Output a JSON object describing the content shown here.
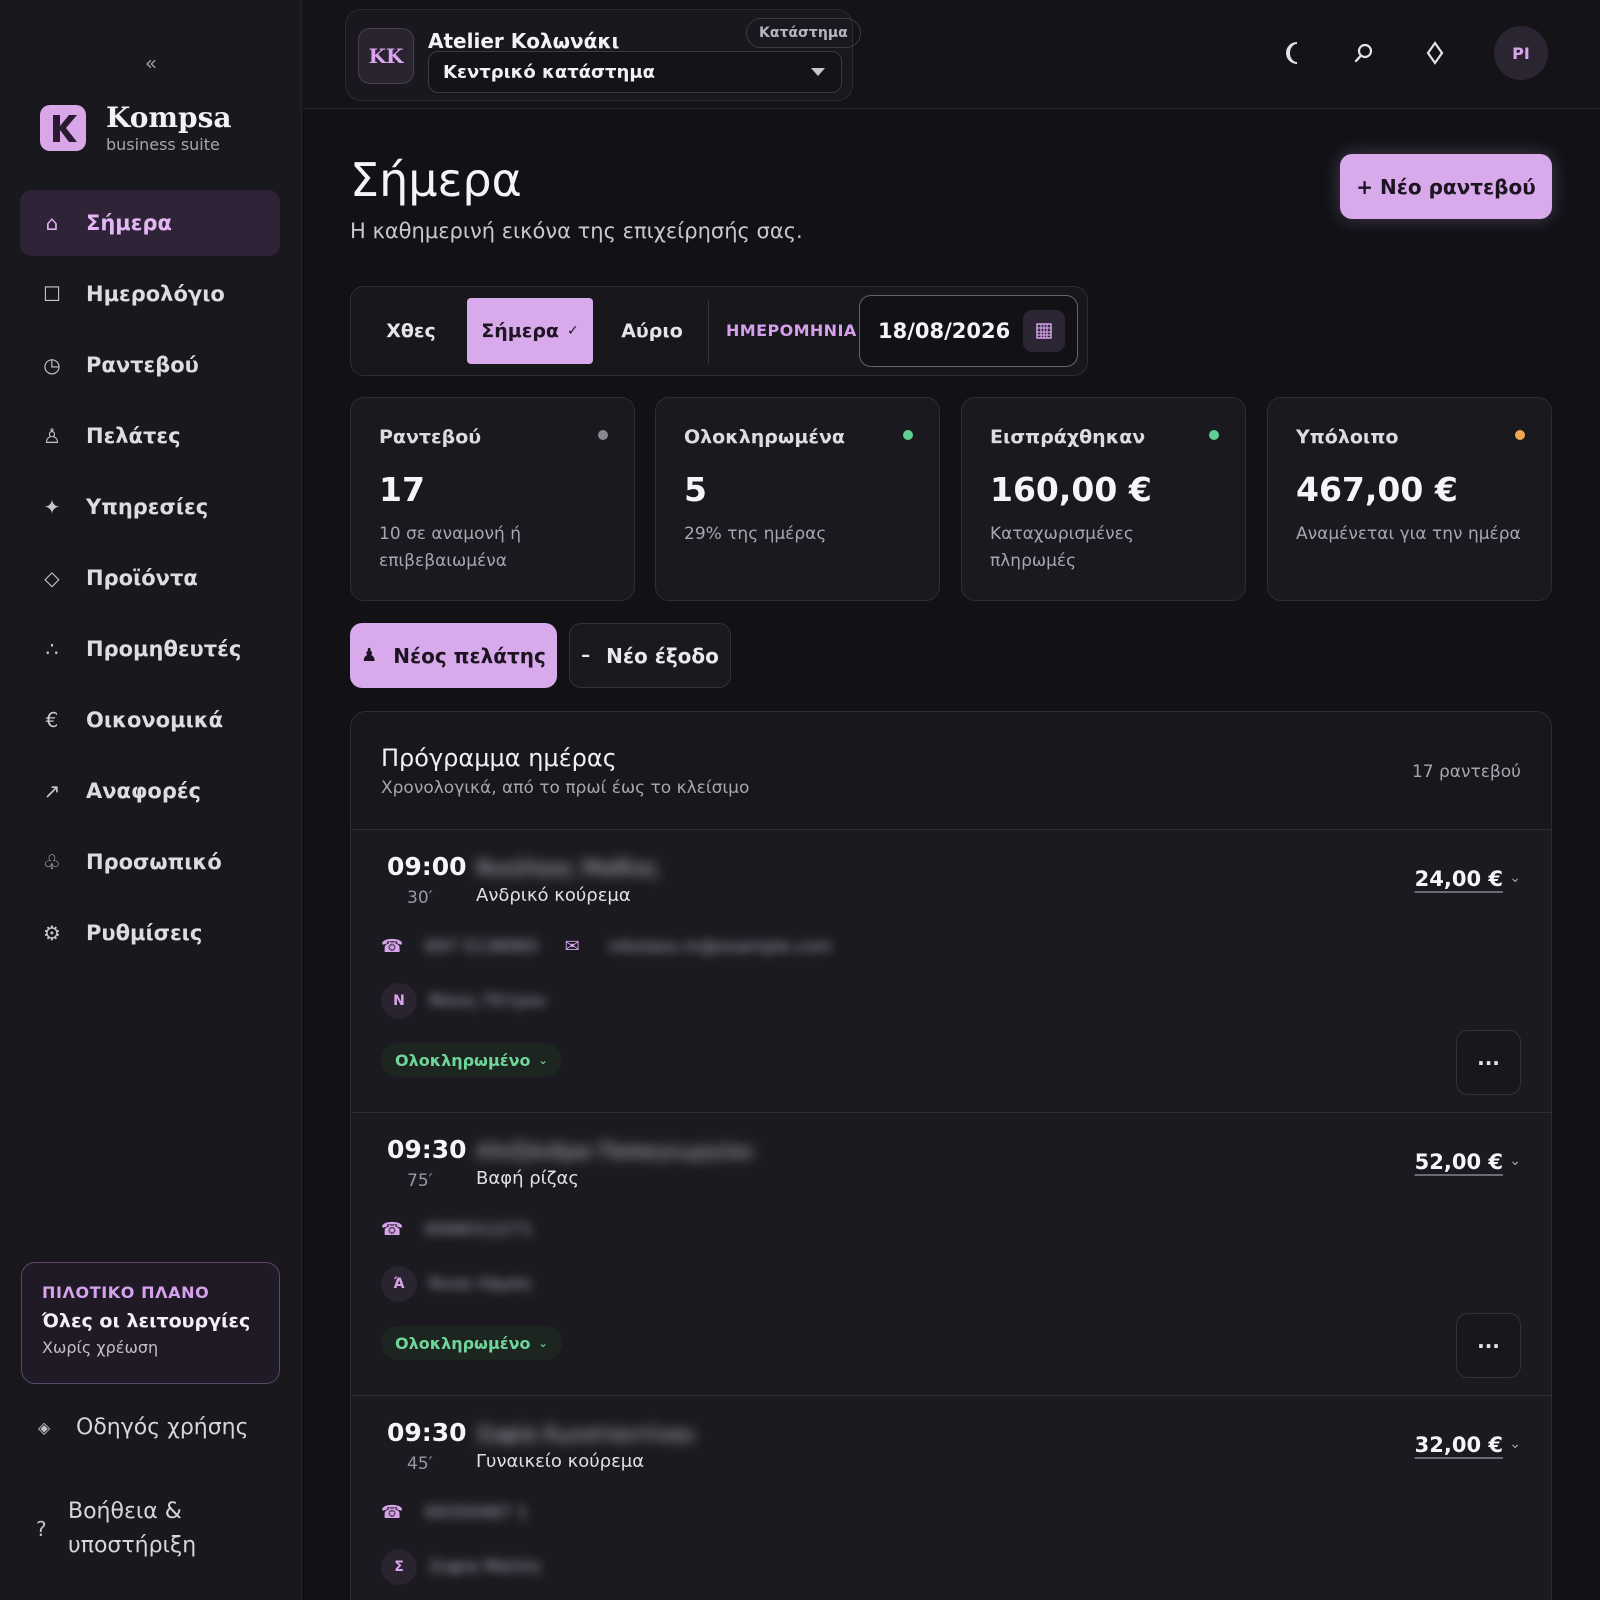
{
  "sidebar": {
    "collapse_icon": "«",
    "brand": {
      "name": "Kompsa",
      "subtitle": "business suite"
    },
    "items": [
      {
        "label": "Σήμερα",
        "icon": "home-icon",
        "glyph": "⌂",
        "active": true
      },
      {
        "label": "Ημερολόγιο",
        "icon": "calendar-icon",
        "glyph": "☐"
      },
      {
        "label": "Ραντεβού",
        "icon": "clock-icon",
        "glyph": "◷"
      },
      {
        "label": "Πελάτες",
        "icon": "person-icon",
        "glyph": "♙"
      },
      {
        "label": "Υπηρεσίες",
        "icon": "sparkle-icon",
        "glyph": "✦"
      },
      {
        "label": "Προϊόντα",
        "icon": "diamond-icon",
        "glyph": "◇"
      },
      {
        "label": "Προμηθευτές",
        "icon": "dots-icon",
        "glyph": "∴"
      },
      {
        "label": "Οικονομικά",
        "icon": "euro-icon",
        "glyph": "€"
      },
      {
        "label": "Αναφορές",
        "icon": "arrow-up-right-icon",
        "glyph": "↗"
      },
      {
        "label": "Προσωπικό",
        "icon": "club-icon",
        "glyph": "♧"
      },
      {
        "label": "Ρυθμίσεις",
        "icon": "gear-icon",
        "glyph": "⚙"
      }
    ],
    "plan": {
      "kicker": "ΠΙΛΟΤΙΚΟ ΠΛΑΝΟ",
      "title": "Όλες οι λειτουργίες",
      "subtitle": "Χωρίς χρέωση"
    },
    "guide_label": "Οδηγός χρήσης",
    "help_label": "Βοήθεια & υποστήριξη"
  },
  "topbar": {
    "store": {
      "initials": "KK",
      "name": "Atelier Κολωνάκι",
      "badge": "Κατάστημα",
      "selected": "Κεντρικό κατάστημα"
    },
    "icons": [
      "moon-icon",
      "search-icon",
      "diamond-icon"
    ],
    "user_initials": "PI"
  },
  "page": {
    "title": "Σήμερα",
    "subtitle": "Η καθημερινή εικόνα της επιχείρησής σας.",
    "new_appointment": "+ Νέο ραντεβού"
  },
  "date_filter": {
    "yesterday": "Χθες",
    "today": "Σήμερα",
    "today_check": "✓",
    "tomorrow": "Αύριο",
    "date_label": "ΗΜΕΡΟΜΗΝΙΑ",
    "date_value": "18/08/2026"
  },
  "stats": [
    {
      "title": "Ραντεβού",
      "value": "17",
      "note": "10 σε αναμονή ή επιβεβαιωμένα",
      "dot_color": "#8a8790"
    },
    {
      "title": "Ολοκληρωμένα",
      "value": "5",
      "note": "29% της ημέρας",
      "dot_color": "#5fcf93"
    },
    {
      "title": "Εισπράχθηκαν",
      "value": "160,00 €",
      "note": "Καταχωρισμένες πληρωμές",
      "dot_color": "#5fcf93"
    },
    {
      "title": "Υπόλοιπο",
      "value": "467,00 €",
      "note": "Αναμένεται για την ημέρα",
      "dot_color": "#f0a850"
    }
  ],
  "actions": {
    "new_client": "Νέος πελάτης",
    "new_expense": "Νέο έξοδο"
  },
  "schedule": {
    "title": "Πρόγραμμα ημέρας",
    "subtitle": "Χρονολογικά, από το πρωί έως το κλείσιμο",
    "count": "17 ραντεβού",
    "appointments": [
      {
        "time": "09:00",
        "duration": "30′",
        "client": "Νικόλαος Μαθίος",
        "service": "Ανδρικό κούρεμα",
        "price": "24,00 €",
        "phone": "697 5138065",
        "email": "nikolaos.m@example.com",
        "staff_initial": "N",
        "staff_name": "Νίκος Πέτρου",
        "status": "Ολοκληρωμένο"
      },
      {
        "time": "09:30",
        "duration": "75′",
        "client": "Αλεξάνδρα Παπαγεωργίου",
        "service": "Βαφή ρίζας",
        "price": "52,00 €",
        "phone": "6948312271",
        "email": "",
        "staff_initial": "Ά",
        "staff_name": "Άννα Λάμπη",
        "status": "Ολοκληρωμένο"
      },
      {
        "time": "09:30",
        "duration": "45′",
        "client": "Σοφία Κωνσταντίνου",
        "service": "Γυναικείο κούρεμα",
        "price": "32,00 €",
        "phone": "69350487 1",
        "email": "",
        "staff_initial": "Σ",
        "staff_name": "Σοφία Μάλλη",
        "status": ""
      }
    ]
  },
  "colors": {
    "accent": "#d9aaeb",
    "background": "#111116",
    "success": "#5fcf93",
    "warning": "#f0a850"
  }
}
